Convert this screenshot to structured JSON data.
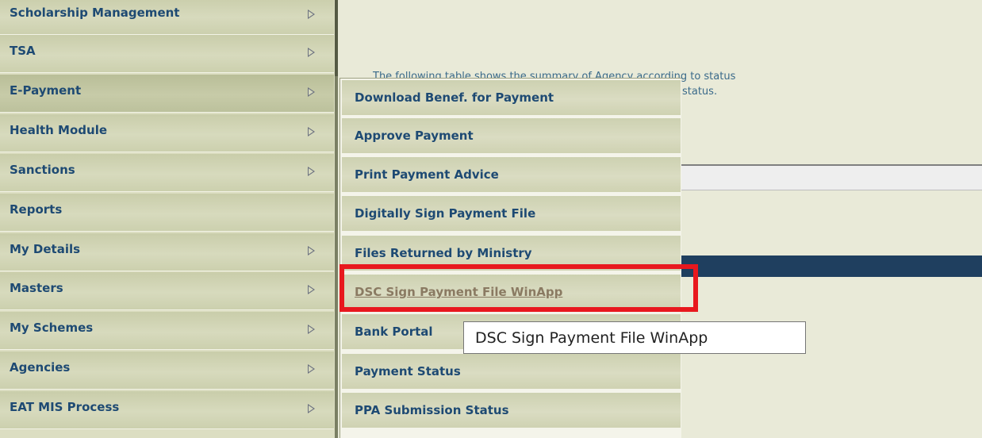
{
  "side_menu": {
    "items": [
      {
        "label": "Scholarship Management",
        "has_submenu": true
      },
      {
        "label": "TSA",
        "has_submenu": true
      },
      {
        "label": "E-Payment",
        "has_submenu": true,
        "active": true
      },
      {
        "label": "Health Module",
        "has_submenu": true
      },
      {
        "label": "Sanctions",
        "has_submenu": true
      },
      {
        "label": "Reports",
        "has_submenu": false
      },
      {
        "label": "My Details",
        "has_submenu": true
      },
      {
        "label": "Masters",
        "has_submenu": true
      },
      {
        "label": "My Schemes",
        "has_submenu": true
      },
      {
        "label": "Agencies",
        "has_submenu": true
      },
      {
        "label": "EAT MIS Process",
        "has_submenu": true
      }
    ]
  },
  "content": {
    "line1": "The following table shows the summary of Agency according to status",
    "line2": "status."
  },
  "submenu": {
    "items": [
      {
        "label": "Download Benef. for Payment"
      },
      {
        "label": "Approve Payment"
      },
      {
        "label": "Print Payment Advice"
      },
      {
        "label": "Digitally Sign Payment File"
      },
      {
        "label": "Files Returned by Ministry"
      },
      {
        "label": "DSC Sign Payment File WinApp",
        "highlighted": true
      },
      {
        "label": "Bank Portal"
      },
      {
        "label": "Payment Status"
      },
      {
        "label": "PPA Submission Status"
      }
    ]
  },
  "tooltip": {
    "text": "DSC Sign Payment File WinApp"
  },
  "colors": {
    "highlight_box": "#e8181e",
    "menu_text": "#1e4a73",
    "header_bar": "#1f3f5f"
  }
}
